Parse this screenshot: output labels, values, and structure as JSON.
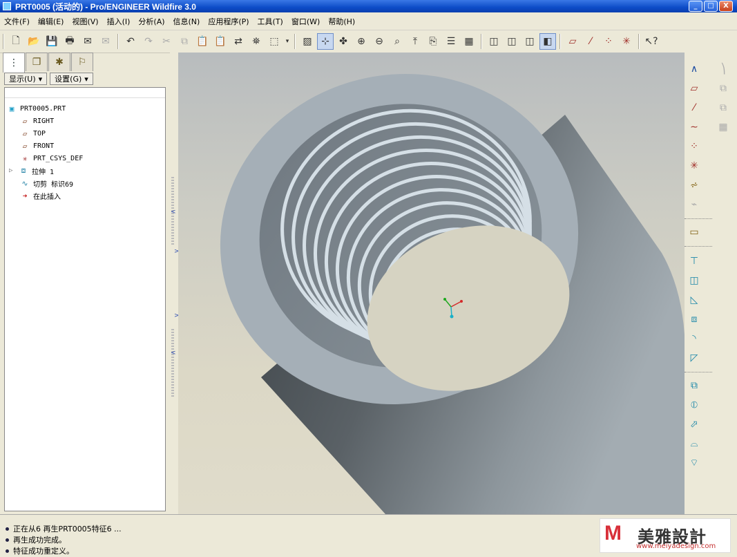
{
  "window": {
    "title": "PRT0005 (活动的) - Pro/ENGINEER Wildfire 3.0",
    "min_label": "_",
    "max_label": "□",
    "close_label": "X"
  },
  "menu": [
    "文件(F)",
    "编辑(E)",
    "视图(V)",
    "插入(I)",
    "分析(A)",
    "信息(N)",
    "应用程序(P)",
    "工具(T)",
    "窗口(W)",
    "帮助(H)"
  ],
  "toolbar": {
    "groups": [
      [
        "new-file-icon",
        "open-folder-icon",
        "save-icon",
        "print-icon",
        "send-mail-icon",
        "mail-attach-icon"
      ],
      [
        "undo-icon",
        "redo-icon",
        "cut-icon",
        "copy-icon",
        "paste-icon",
        "paste-special-icon",
        "regenerate-icon",
        "find-icon",
        "select-box-icon",
        "dropdown-icon"
      ],
      [
        "repaint-icon",
        "spin-center-icon",
        "orient-mode-icon",
        "zoom-in-icon",
        "zoom-out-icon",
        "refit-icon",
        "reorient-icon",
        "saved-views-icon",
        "layers-icon",
        "view-manager-icon"
      ],
      [
        "wireframe-icon",
        "hidden-line-icon",
        "no-hidden-icon",
        "shading-icon"
      ],
      [
        "datum-planes-icon",
        "datum-axes-icon",
        "datum-points-icon",
        "coordinate-systems-icon"
      ],
      [
        "context-help-icon"
      ]
    ],
    "pressed": [
      "spin-center-icon",
      "shading-icon"
    ]
  },
  "panel": {
    "tabs": [
      "model-tree-icon",
      "folder-browser-icon",
      "favorites-icon",
      "connections-icon"
    ],
    "show_button": "显示(U)",
    "settings_button": "设置(G)",
    "tree": [
      {
        "label": "PRT0005.PRT",
        "icon": "part-icon",
        "level": 0,
        "expand": ""
      },
      {
        "label": "RIGHT",
        "icon": "datum-plane-icon",
        "level": 1,
        "expand": ""
      },
      {
        "label": "TOP",
        "icon": "datum-plane-icon",
        "level": 1,
        "expand": ""
      },
      {
        "label": "FRONT",
        "icon": "datum-plane-icon",
        "level": 1,
        "expand": ""
      },
      {
        "label": "PRT_CSYS_DEF",
        "icon": "csys-icon",
        "level": 1,
        "expand": ""
      },
      {
        "label": "拉伸 1",
        "icon": "extrude-icon",
        "level": 1,
        "expand": "▷"
      },
      {
        "label": "切剪 标识69",
        "icon": "helical-sweep-icon",
        "level": 1,
        "expand": ""
      },
      {
        "label": "在此插入",
        "icon": "insert-here-arrow-icon",
        "level": 1,
        "expand": ""
      }
    ]
  },
  "colors": {
    "viewport_top": "#b8bcbe",
    "viewport_bottom": "#e0dccb",
    "part_light": "#a9b3bc",
    "part_dark": "#4b5155",
    "thread_light": "#d5dfe6"
  },
  "right_toolbar": [
    "sketched-datum-icon",
    "datum-plane-tool-icon",
    "datum-axis-tool-icon",
    "datum-curve-icon",
    "datum-point-icon",
    "csys-tool-icon",
    "analysis-icon",
    "insert-datum-icon",
    "sketch-tool-icon",
    "extrude-tool-icon",
    "revolve-tool-icon",
    "variable-sweep-icon",
    "blend-icon",
    "round-icon",
    "chamfer-icon",
    "hole-icon",
    "shell-icon",
    "rib-icon",
    "draft-icon",
    "trim-icon",
    "mirror-icon",
    "merge-icon",
    "pattern-icon",
    "intersect-icon"
  ],
  "status": {
    "messages": [
      "正在从6 再生PRT0005特征6 ...",
      "再生成功完成。",
      "特征成功重定义。"
    ]
  },
  "watermark": {
    "logo": "M",
    "name": "美雅設計",
    "url": "www.meiyadesign.com"
  }
}
